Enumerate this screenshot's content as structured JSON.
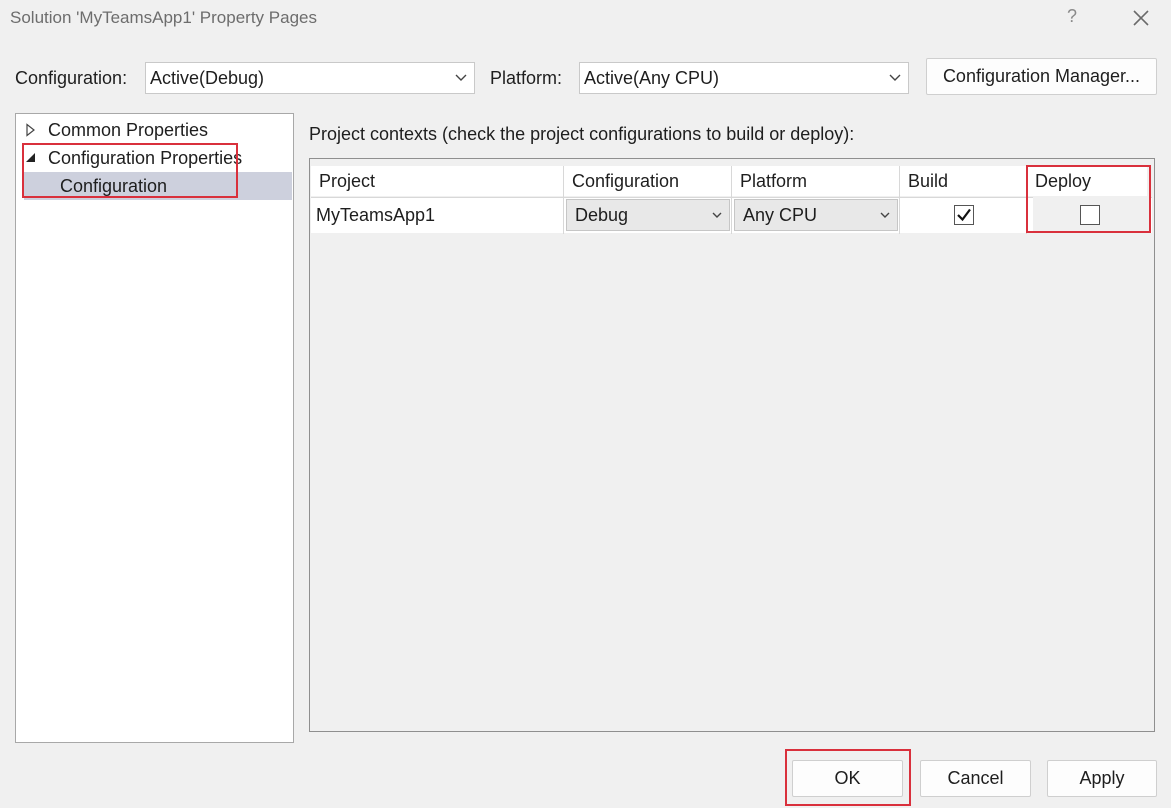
{
  "window": {
    "title": "Solution 'MyTeamsApp1' Property Pages",
    "help_label": "?"
  },
  "toolbar": {
    "configuration_label": "Configuration:",
    "configuration_value": "Active(Debug)",
    "platform_label": "Platform:",
    "platform_value": "Active(Any CPU)",
    "config_manager_label": "Configuration Manager..."
  },
  "tree": {
    "items": [
      {
        "label": "Common Properties",
        "expanded": false
      },
      {
        "label": "Configuration Properties",
        "expanded": true
      },
      {
        "label": "Configuration",
        "selected": true
      }
    ]
  },
  "main": {
    "heading": "Project contexts (check the project configurations to build or deploy):",
    "columns": [
      "Project",
      "Configuration",
      "Platform",
      "Build",
      "Deploy"
    ],
    "rows": [
      {
        "project": "MyTeamsApp1",
        "configuration": "Debug",
        "platform": "Any CPU",
        "build": true,
        "deploy": false
      }
    ]
  },
  "footer": {
    "ok_label": "OK",
    "cancel_label": "Cancel",
    "apply_label": "Apply"
  },
  "colors": {
    "highlight": "#d9303c",
    "selection": "#cdd0dd"
  },
  "icons": [
    "close-icon",
    "help-icon",
    "chevron-down-icon",
    "expand-arrow-icon",
    "collapse-arrow-icon",
    "checkmark-icon"
  ]
}
